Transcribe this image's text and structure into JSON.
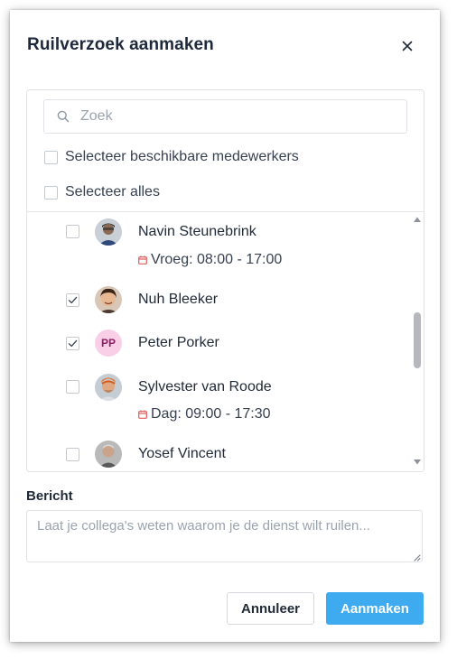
{
  "dialog": {
    "title": "Ruilverzoek aanmaken",
    "close_icon": "close-icon"
  },
  "search": {
    "placeholder": "Zoek",
    "value": "",
    "icon": "search-icon"
  },
  "options": {
    "select_available": {
      "label": "Selecteer beschikbare medewerkers",
      "checked": false
    },
    "select_all": {
      "label": "Selecteer alles",
      "checked": false
    }
  },
  "employees": [
    {
      "name": "Navin Steunebrink",
      "checked": false,
      "avatar": "photo-avatar",
      "shift": "Vroeg: 08:00 - 17:00"
    },
    {
      "name": "Nuh Bleeker",
      "checked": true,
      "avatar": "photo-avatar"
    },
    {
      "name": "Peter Porker",
      "checked": true,
      "avatar": "initials-avatar",
      "initials": "PP"
    },
    {
      "name": "Sylvester van Roode",
      "checked": false,
      "avatar": "photo-avatar",
      "shift": "Dag: 09:00 - 17:30"
    },
    {
      "name": "Yosef Vincent",
      "checked": false,
      "avatar": "photo-avatar"
    }
  ],
  "message": {
    "label": "Bericht",
    "placeholder": "Laat je collega's weten waarom je de dienst wilt ruilen...",
    "value": ""
  },
  "buttons": {
    "cancel": "Annuleer",
    "create": "Aanmaken"
  },
  "colors": {
    "primary": "#3eaaf0",
    "shift_icon": "#e05a5a",
    "initials_bg": "#f9cfe8",
    "initials_text": "#8b1e63"
  }
}
